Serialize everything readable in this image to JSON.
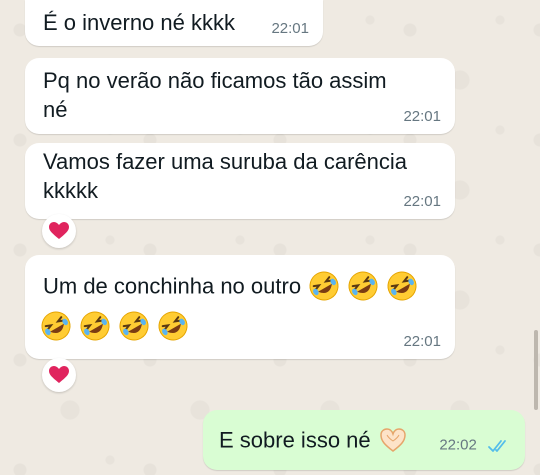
{
  "messages": [
    {
      "id": 1,
      "direction": "in",
      "text": "É o inverno né kkkk",
      "time": "22:01"
    },
    {
      "id": 2,
      "direction": "in",
      "text": "Pq no verão não ficamos tão assim né",
      "line1": "Pq no verão não ficamos tão assim",
      "line2": "né",
      "time": "22:01"
    },
    {
      "id": 3,
      "direction": "in",
      "text": "Vamos fazer uma suruba da carência kkkkk",
      "line1": "Vamos fazer uma suruba da carência",
      "line2": "kkkkk",
      "time": "22:01",
      "reaction": "red-heart"
    },
    {
      "id": 4,
      "direction": "in",
      "text": "Um de conchinha no outro",
      "emojis_line1": 3,
      "emojis_line2": 4,
      "emoji": "rolling-on-floor-laughing",
      "time": "22:01",
      "reaction": "red-heart"
    },
    {
      "id": 5,
      "direction": "out",
      "text": "E sobre isso né",
      "emoji": "heart-hands",
      "time": "22:02",
      "status": "read",
      "status_color": "#53bdeb"
    }
  ],
  "colors": {
    "incoming": "#ffffff",
    "outgoing": "#d9fdd3",
    "background": "#efeae2",
    "timestamp": "#667781",
    "heart": "#e0245e"
  }
}
